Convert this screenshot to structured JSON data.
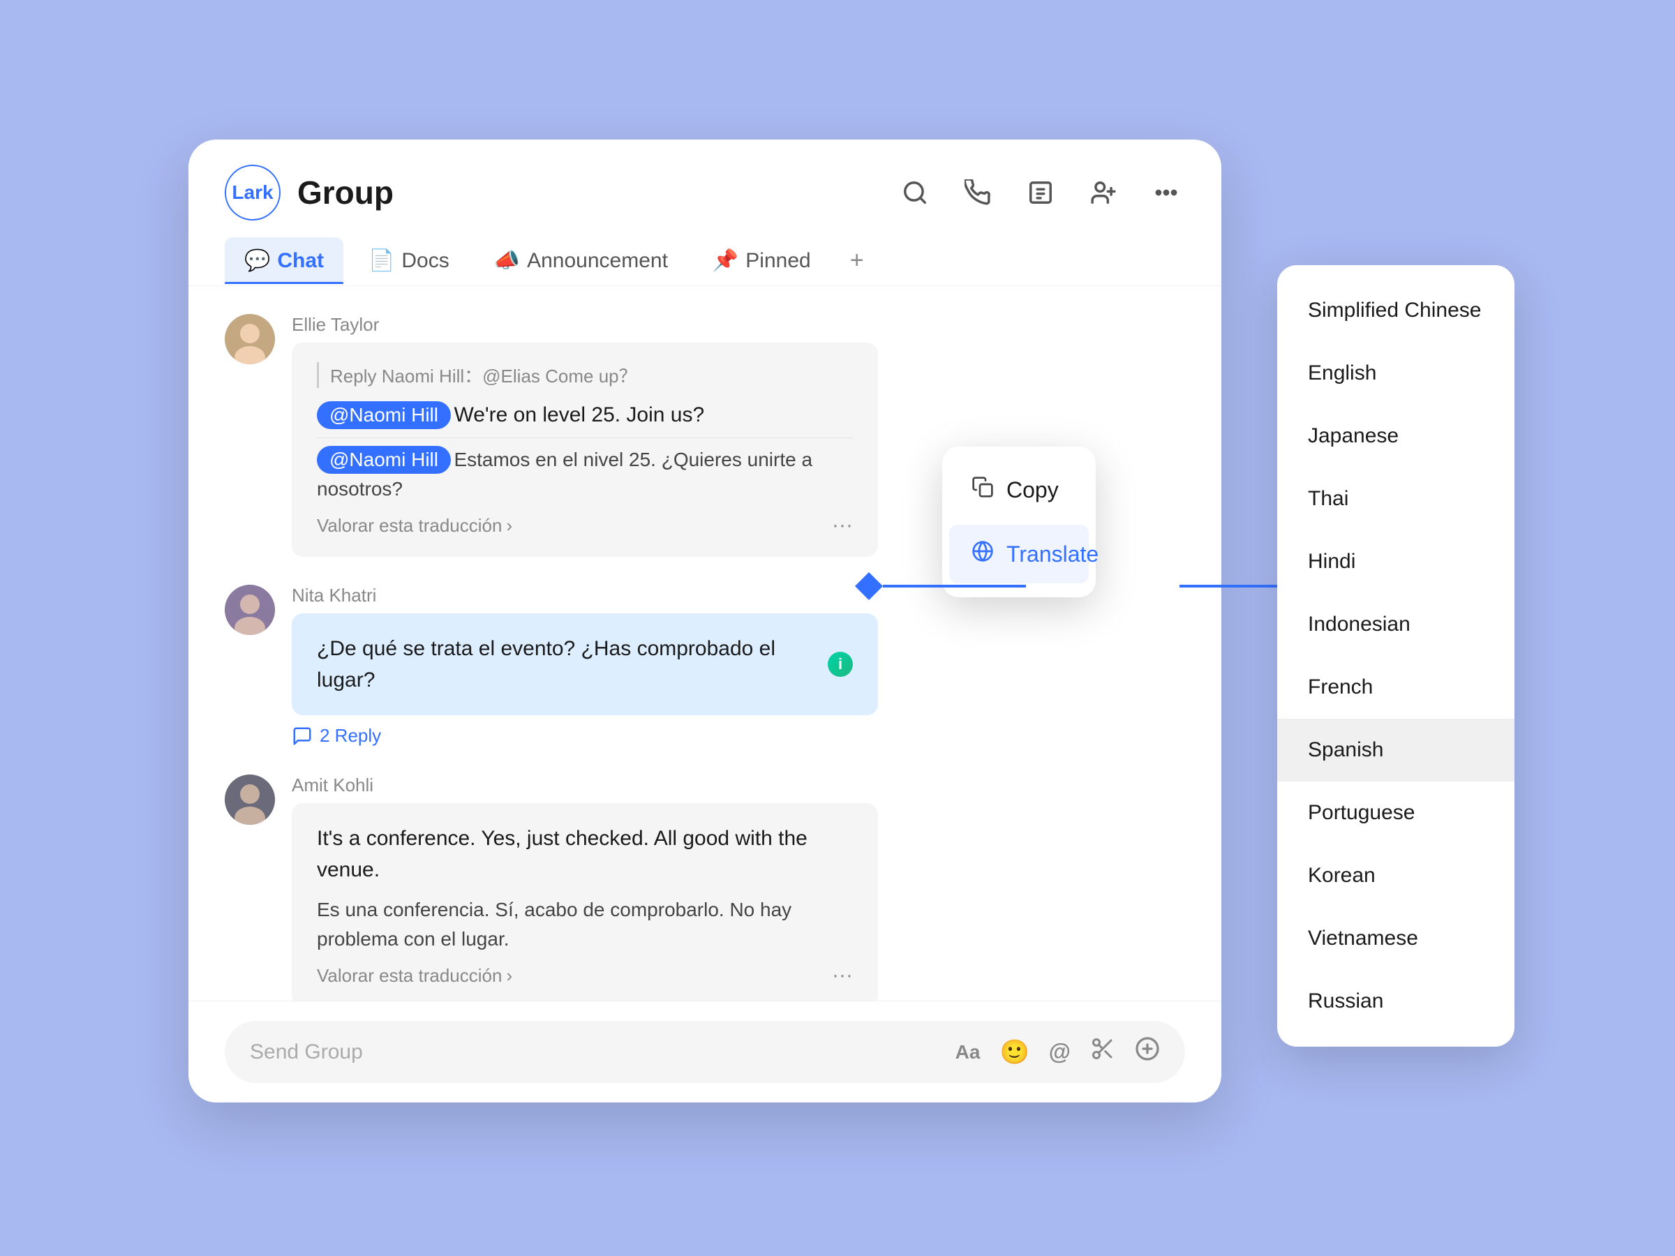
{
  "app": {
    "logo_text": "Lark",
    "group_title": "Group",
    "bg_color": "#a8b8f0"
  },
  "header": {
    "tabs": [
      {
        "id": "chat",
        "label": "Chat",
        "icon": "💬",
        "active": true
      },
      {
        "id": "docs",
        "label": "Docs",
        "icon": "📄",
        "active": false
      },
      {
        "id": "announcement",
        "label": "Announcement",
        "icon": "📣",
        "active": false
      },
      {
        "id": "pinned",
        "label": "Pinned",
        "icon": "📌",
        "active": false
      }
    ],
    "icons": [
      "search",
      "phone",
      "info",
      "add-user",
      "more"
    ]
  },
  "messages": [
    {
      "id": "msg1",
      "sender": "Ellie Taylor",
      "avatar_type": "ellie",
      "reply_to": "Reply Naomi Hill：@Elias Come up？",
      "mention": "@Naomi Hill",
      "text": "We're on level 25. Join us?",
      "translated": "Estamos en el nivel 25. ¿Quieres unirte a nosotros?",
      "valorar": "Valorar esta traducción",
      "has_more": true
    },
    {
      "id": "msg2",
      "sender": "Nita Khatri",
      "avatar_type": "nita",
      "text": "¿De qué se trata el evento? ¿Has comprobado el lugar?",
      "reply_count": "2 Reply",
      "has_info": true
    },
    {
      "id": "msg3",
      "sender": "Amit Kohli",
      "avatar_type": "amit",
      "text": "It's a conference. Yes, just checked. All good with the venue.",
      "translated": "Es una conferencia. Sí, acabo de comprobarlo. No hay problema con el lugar.",
      "valorar": "Valorar esta traducción",
      "has_more": true
    }
  ],
  "input": {
    "placeholder": "Send Group"
  },
  "context_menu": {
    "copy_label": "Copy",
    "translate_label": "Translate"
  },
  "language_panel": {
    "languages": [
      {
        "id": "simplified-chinese",
        "label": "Simplified Chinese",
        "selected": false
      },
      {
        "id": "english",
        "label": "English",
        "selected": false
      },
      {
        "id": "japanese",
        "label": "Japanese",
        "selected": false
      },
      {
        "id": "thai",
        "label": "Thai",
        "selected": false
      },
      {
        "id": "hindi",
        "label": "Hindi",
        "selected": false
      },
      {
        "id": "indonesian",
        "label": "Indonesian",
        "selected": false
      },
      {
        "id": "french",
        "label": "French",
        "selected": false
      },
      {
        "id": "spanish",
        "label": "Spanish",
        "selected": true
      },
      {
        "id": "portuguese",
        "label": "Portuguese",
        "selected": false
      },
      {
        "id": "korean",
        "label": "Korean",
        "selected": false
      },
      {
        "id": "vietnamese",
        "label": "Vietnamese",
        "selected": false
      },
      {
        "id": "russian",
        "label": "Russian",
        "selected": false
      }
    ]
  }
}
